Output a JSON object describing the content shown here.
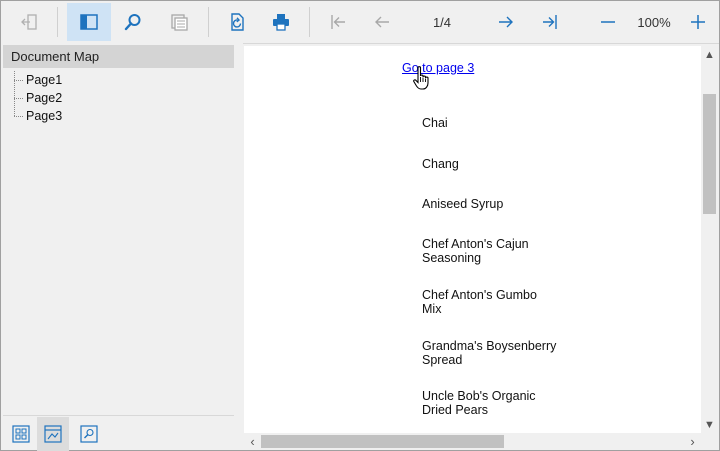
{
  "toolbar": {
    "page_indicator": "1/4",
    "zoom_level": "100%",
    "accent_color": "#1e73be"
  },
  "document_map": {
    "title": "Document Map",
    "items": [
      "Page1",
      "Page2",
      "Page3"
    ]
  },
  "page": {
    "link_text": "Go to page 3",
    "products": [
      "Chai",
      "Chang",
      "Aniseed Syrup",
      "Chef Anton's Cajun Seasoning",
      "Chef Anton's Gumbo Mix",
      "Grandma's Boysenberry Spread",
      "Uncle Bob's Organic Dried Pears"
    ]
  }
}
